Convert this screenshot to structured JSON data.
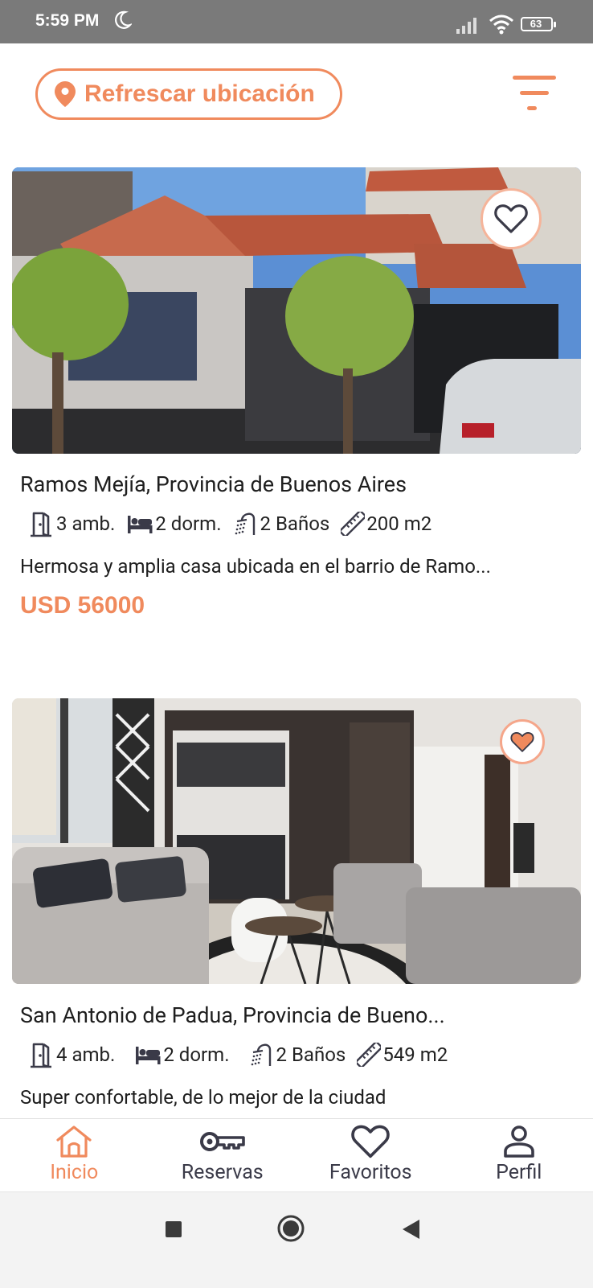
{
  "status_bar": {
    "time": "5:59 PM",
    "battery": "63"
  },
  "header": {
    "refresh_label": "Refrescar ubicación"
  },
  "listings": [
    {
      "title": "Ramos Mejía, Provincia de Buenos Aires",
      "rooms": "3 amb.",
      "bedrooms": "2 dorm.",
      "baths": "2 Baños",
      "area": "200 m2",
      "description": "Hermosa y amplia casa ubicada en el barrio de Ramo...",
      "price": "USD 56000",
      "favorited": false
    },
    {
      "title": "San Antonio de Padua, Provincia de Bueno...",
      "rooms": "4 amb.",
      "bedrooms": "2 dorm.",
      "baths": "2 Baños",
      "area": "549 m2",
      "description": "Super confortable, de lo mejor de la ciudad",
      "favorited": true
    }
  ],
  "bottom_nav": [
    {
      "label": "Inicio",
      "icon": "home-icon",
      "active": true
    },
    {
      "label": "Reservas",
      "icon": "key-icon",
      "active": false
    },
    {
      "label": "Favoritos",
      "icon": "heart-icon",
      "active": false
    },
    {
      "label": "Perfil",
      "icon": "person-icon",
      "active": false
    }
  ],
  "colors": {
    "accent": "#f08a5d",
    "nav_inactive": "#3a3a48",
    "status_bar": "#7a7a7a"
  }
}
